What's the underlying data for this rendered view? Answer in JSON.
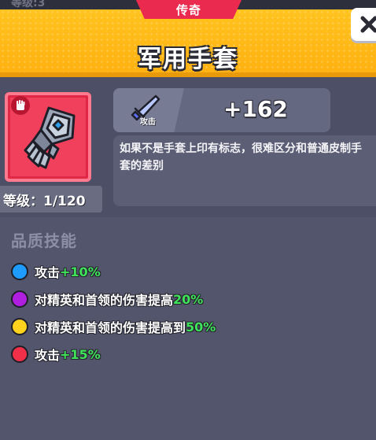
{
  "top_partial": "等级:3",
  "header": {
    "rarity": "传奇",
    "title": "军用手套",
    "rarity_color": "#ea2b4f",
    "background_color": "#ffb312"
  },
  "item": {
    "icon": "gauntlet-icon",
    "rarity_badge_icon": "hand-icon",
    "level_text": "等级：1/120"
  },
  "stat": {
    "icon": "sword-icon",
    "label": "攻击",
    "value": "+162"
  },
  "description": "如果不是手套上印有标志，很难区分和普通皮制手套的差别",
  "skills": {
    "heading": "品质技能",
    "items": [
      {
        "text": "攻击",
        "value": "+10%",
        "dot_color": "#1e9bff"
      },
      {
        "text": "对精英和首领的伤害提高",
        "value": "20%",
        "dot_color": "#b01ee0"
      },
      {
        "text": "对精英和首领的伤害提高到",
        "value": "50%",
        "dot_color": "#ffd21e"
      },
      {
        "text": "攻击",
        "value": "+15%",
        "dot_color": "#f03048"
      }
    ]
  },
  "close_button": {
    "icon": "close-icon"
  }
}
